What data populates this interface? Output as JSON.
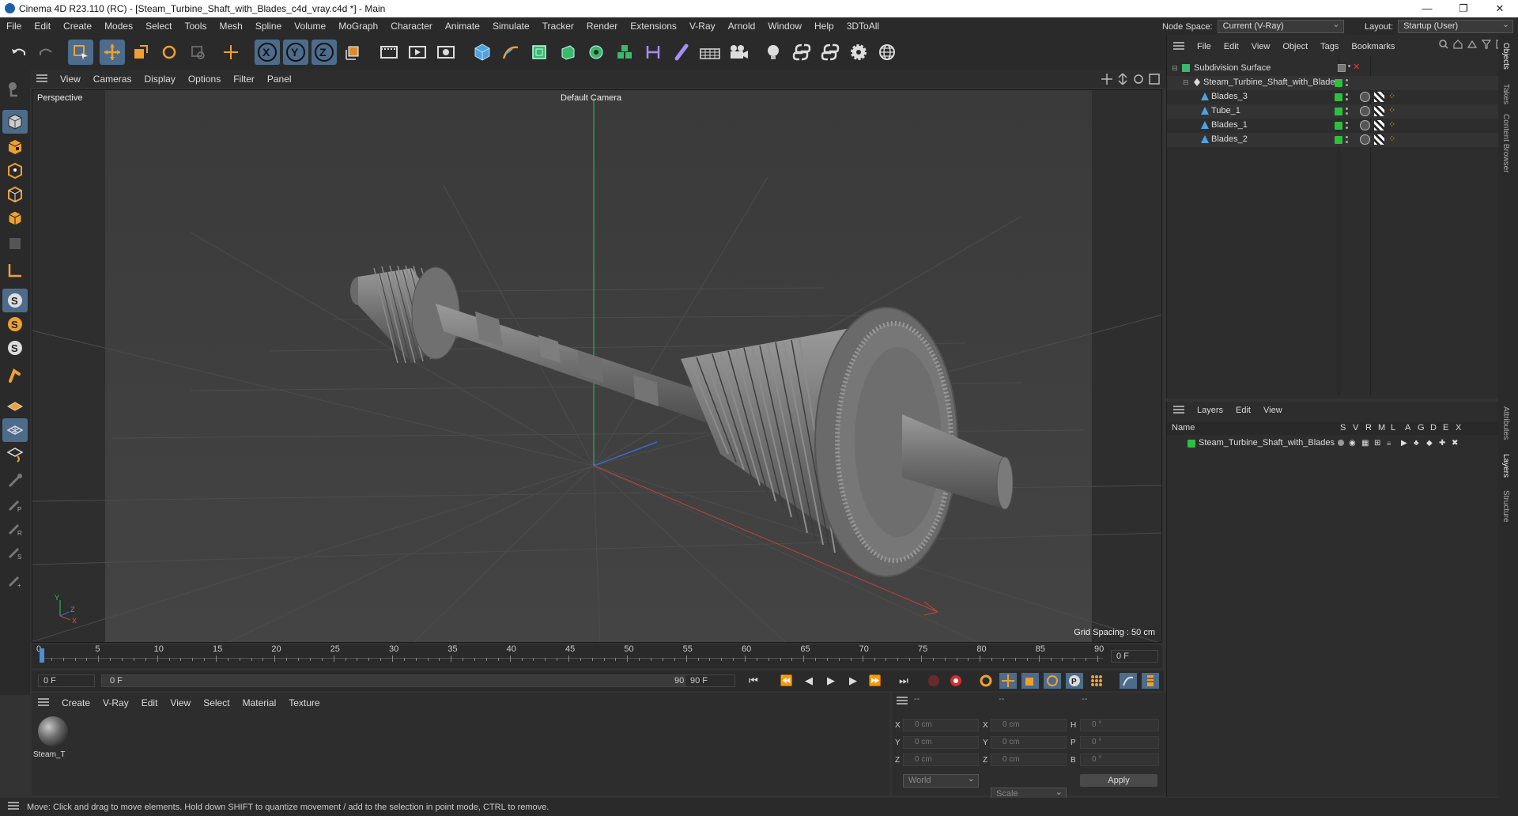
{
  "titlebar": {
    "title": "Cinema 4D R23.110 (RC) - [Steam_Turbine_Shaft_with_Blades_c4d_vray.c4d *] - Main"
  },
  "menubar": {
    "items": [
      "File",
      "Edit",
      "Create",
      "Modes",
      "Select",
      "Tools",
      "Mesh",
      "Spline",
      "Volume",
      "MoGraph",
      "Character",
      "Animate",
      "Simulate",
      "Tracker",
      "Render",
      "Extensions",
      "V-Ray",
      "Arnold",
      "Window",
      "Help",
      "3DToAll"
    ]
  },
  "nodespace": {
    "label": "Node Space:",
    "value": "Current (V-Ray)"
  },
  "layout": {
    "label": "Layout:",
    "value": "Startup (User)"
  },
  "viewport": {
    "menu": [
      "View",
      "Cameras",
      "Display",
      "Options",
      "Filter",
      "Panel"
    ],
    "projection": "Perspective",
    "camera": "Default Camera",
    "grid_spacing": "Grid Spacing : 50 cm",
    "axis_labels": {
      "y": "Y",
      "z": "Z",
      "x": "X"
    }
  },
  "timeline": {
    "ticks": [
      "0",
      "5",
      "10",
      "15",
      "20",
      "25",
      "30",
      "35",
      "40",
      "45",
      "50",
      "55",
      "60",
      "65",
      "70",
      "75",
      "80",
      "85",
      "90"
    ],
    "current_frame": "0 F"
  },
  "transport": {
    "start_frame": "0 F",
    "range_start": "0 F",
    "range_end": "90 F",
    "end_frame": "90 F"
  },
  "material": {
    "menu": [
      "Create",
      "V-Ray",
      "Edit",
      "View",
      "Select",
      "Material",
      "Texture"
    ],
    "name": "Steam_T"
  },
  "coords": {
    "header_a": "--",
    "header_b": "--",
    "header_c": "--",
    "x_pos": "0 cm",
    "y_pos": "0 cm",
    "z_pos": "0 cm",
    "x_size": "0 cm",
    "y_size": "0 cm",
    "z_size": "0 cm",
    "h": "0 °",
    "p": "0 °",
    "b": "0 °",
    "labels": {
      "x": "X",
      "y": "Y",
      "z": "Z",
      "h": "H",
      "p": "P",
      "b": "B"
    },
    "mode": "World",
    "size_mode": "Scale",
    "apply": "Apply"
  },
  "objects": {
    "menu": [
      "File",
      "Edit",
      "View",
      "Object",
      "Tags",
      "Bookmarks"
    ],
    "tree": [
      {
        "name": "Subdivision Surface",
        "level": 0
      },
      {
        "name": "Steam_Turbine_Shaft_with_Blades",
        "level": 1
      },
      {
        "name": "Blades_3",
        "level": 2
      },
      {
        "name": "Tube_1",
        "level": 2
      },
      {
        "name": "Blades_1",
        "level": 2
      },
      {
        "name": "Blades_2",
        "level": 2
      }
    ]
  },
  "layers": {
    "menu": [
      "Layers",
      "Edit",
      "View"
    ],
    "columns": [
      "Name",
      "S",
      "V",
      "R",
      "M",
      "L",
      "A",
      "G",
      "D",
      "E",
      "X"
    ],
    "rows": [
      {
        "name": "Steam_Turbine_Shaft_with_Blades",
        "color": "#2fbf3f"
      }
    ]
  },
  "sidetabs": [
    "Objects",
    "Takes",
    "Content Browser",
    "Attributes",
    "Layers",
    "Structure"
  ],
  "status": {
    "text": "Move: Click and drag to move elements. Hold down SHIFT to quantize movement / add to the selection in point mode, CTRL to remove."
  },
  "colors": {
    "accent": "#4d6c8c",
    "layer_green": "#2fbf3f",
    "axis_x": "#c84040",
    "axis_y": "#30c060",
    "axis_z": "#3a6ad0"
  }
}
